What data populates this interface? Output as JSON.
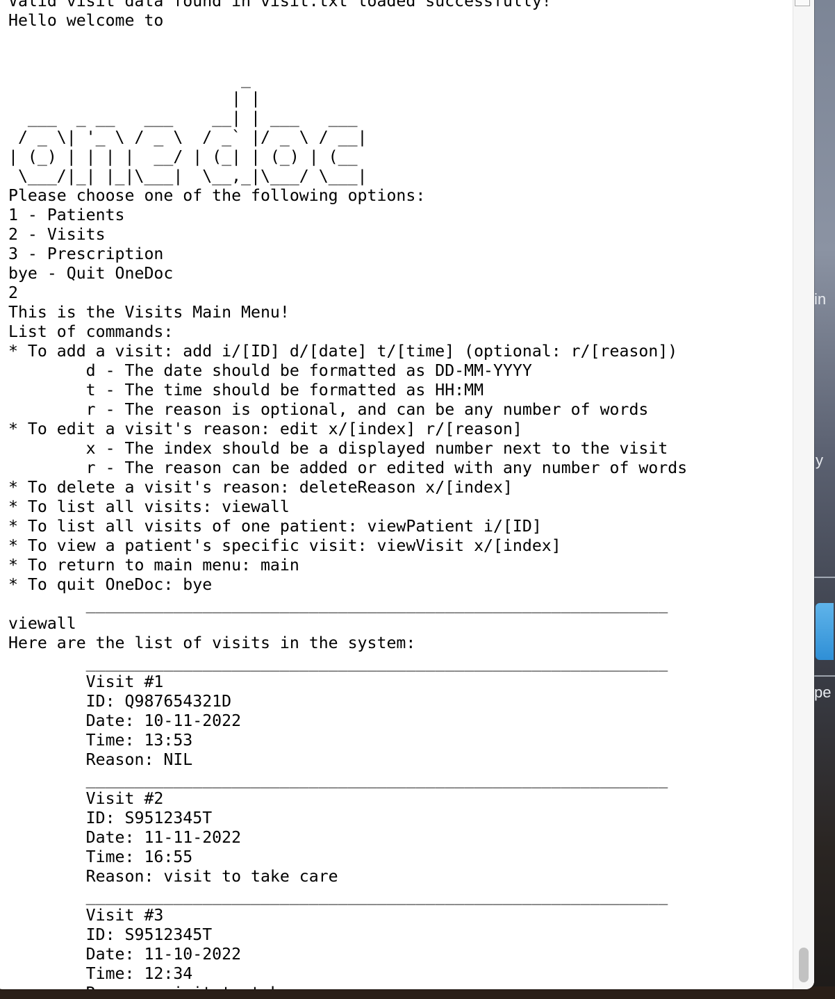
{
  "terminal": {
    "lines": [
      "Valid visit data found in visit.txt loaded successfully!",
      "Hello welcome to",
      "",
      "",
      "                        _",
      "                       | |",
      "  ___  _ __   ___    __| | ___   ___",
      " / _ \\| '_ \\ / _ \\  / _` |/ _ \\ / __|",
      "| (_) | | | |  __/ | (_| | (_) | (__",
      " \\___/|_| |_|\\___|  \\__,_|\\___/ \\___|",
      "Please choose one of the following options:",
      "1 - Patients",
      "2 - Visits",
      "3 - Prescription",
      "bye - Quit OneDoc",
      "2",
      "This is the Visits Main Menu!",
      "List of commands:",
      "* To add a visit: add i/[ID] d/[date] t/[time] (optional: r/[reason])",
      "        d - The date should be formatted as DD-MM-YYYY",
      "        t - The time should be formatted as HH:MM",
      "        r - The reason is optional, and can be any number of words",
      "* To edit a visit's reason: edit x/[index] r/[reason]",
      "        x - The index should be a displayed number next to the visit",
      "        r - The reason can be added or edited with any number of words",
      "* To delete a visit's reason: deleteReason x/[index]",
      "* To list all visits: viewall",
      "* To list all visits of one patient: viewPatient i/[ID]",
      "* To view a patient's specific visit: viewVisit x/[index]",
      "* To return to main menu: main",
      "* To quit OneDoc: bye",
      "        ____________________________________________________________",
      "viewall",
      "Here are the list of visits in the system:",
      "        ____________________________________________________________",
      "        Visit #1",
      "        ID: Q987654321D",
      "        Date: 10-11-2022",
      "        Time: 13:53",
      "        Reason: NIL",
      "        ____________________________________________________________",
      "        Visit #2",
      "        ID: S9512345T",
      "        Date: 11-11-2022",
      "        Time: 16:55",
      "        Reason: visit to take care",
      "        ____________________________________________________________",
      "        Visit #3",
      "        ID: S9512345T",
      "        Date: 11-10-2022",
      "        Time: 12:34",
      "        Reason: visit to take care"
    ]
  },
  "desktop": {
    "peek_text_1": "in",
    "peek_text_2": "y",
    "peek_text_3": "pe"
  },
  "colors": {
    "terminal_bg": "#ffffff",
    "terminal_fg": "#000000"
  }
}
